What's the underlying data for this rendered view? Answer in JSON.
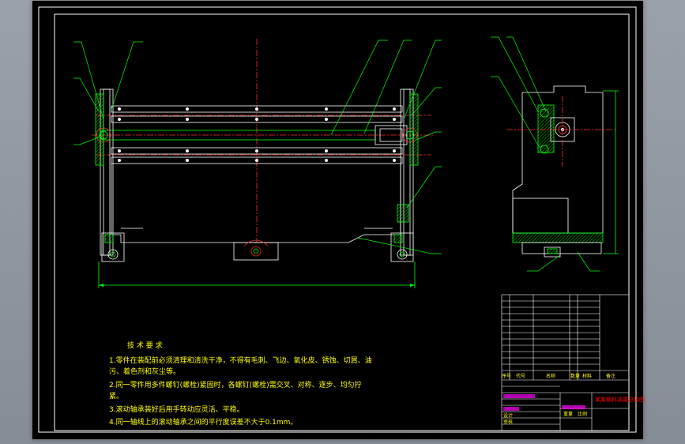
{
  "technical_requirements": {
    "title": "技 术 要 求",
    "lines": [
      "1.零件在装配前必须清理和清洗干净，不得有毛刺、飞边、氧化皮、锈蚀、切屑、油",
      "污、着色剂和灰尘等。",
      "2.同一零件用多件螺钉(螺栓)紧固时，各螺钉(螺栓)需交叉、对称、逐步、均匀拧",
      "紧。",
      "3.滚动轴承装好后用手转动应灵活、平稳。",
      "4.同一轴线上的滚动轴承之间的平行度误差不大于0.1mm。"
    ]
  },
  "title_block": {
    "drawing_name": "某某输料装置总装图",
    "parts_header": [
      "序号",
      "代号",
      "名称",
      "数量",
      "材料",
      "备注"
    ],
    "approval_labels": [
      "标记",
      "处数",
      "分区",
      "更改文件号",
      "签名",
      "年月日"
    ],
    "stage_labels": [
      "设计",
      "审核",
      "工艺",
      "批准"
    ],
    "scale_labels": [
      "阶段标记",
      "重量",
      "比例"
    ]
  },
  "colors": {
    "outline": "#ffffff",
    "hatch": "#00ff00",
    "centerline": "#ff2a2a",
    "leader": "#00ff00",
    "text": "#ffff00",
    "title_red": "#ff0000",
    "magenta": "#ff00ff"
  }
}
